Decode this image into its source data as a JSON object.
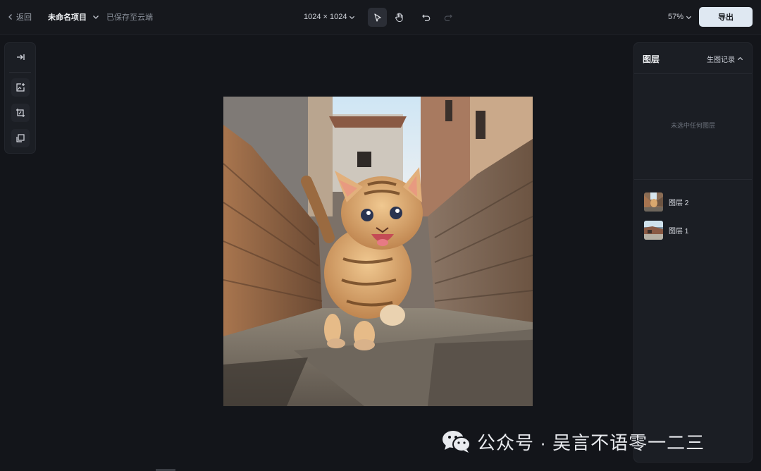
{
  "header": {
    "back_label": "返回",
    "project_name": "未命名项目",
    "save_status": "已保存至云端",
    "canvas_size": "1024 × 1024",
    "zoom": "57%",
    "export_label": "导出"
  },
  "layers_panel": {
    "title": "图层",
    "history_label": "生图记录",
    "empty_message": "未选中任何图层",
    "layers": [
      {
        "name": "图层 2"
      },
      {
        "name": "图层 1"
      }
    ]
  },
  "watermark": {
    "text": "公众号 · 吴言不语零一二三",
    "icon": "wechat-icon"
  },
  "colors": {
    "background": "#13151a",
    "panel": "#1b1e24",
    "export_button": "#dfe8f2"
  }
}
